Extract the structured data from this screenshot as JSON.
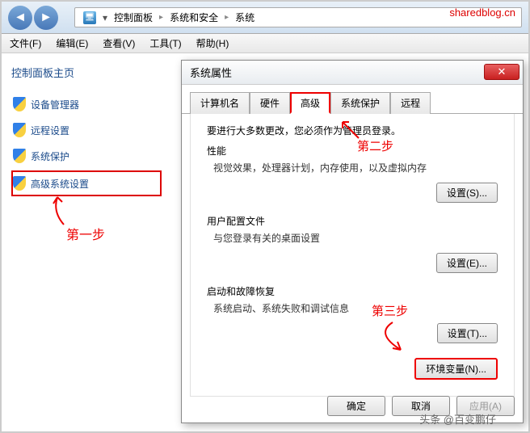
{
  "watermark_top": "sharedblog.cn",
  "watermark_bottom": "头条 @百变鹏仔",
  "nav": {
    "breadcrumb": [
      "控制面板",
      "系统和安全",
      "系统"
    ]
  },
  "menubar": [
    "文件(F)",
    "编辑(E)",
    "查看(V)",
    "工具(T)",
    "帮助(H)"
  ],
  "sidebar": {
    "title": "控制面板主页",
    "items": [
      "设备管理器",
      "远程设置",
      "系统保护",
      "高级系统设置"
    ]
  },
  "annotations": {
    "step1": "第一步",
    "step2": "第二步",
    "step3": "第三步"
  },
  "dialog": {
    "title": "系统属性",
    "close": "✕",
    "tabs": [
      "计算机名",
      "硬件",
      "高级",
      "系统保护",
      "远程"
    ],
    "notice": "要进行大多数更改，您必须作为管理员登录。",
    "sections": [
      {
        "title": "性能",
        "desc": "视觉效果，处理器计划，内存使用，以及虚拟内存",
        "btn": "设置(S)..."
      },
      {
        "title": "用户配置文件",
        "desc": "与您登录有关的桌面设置",
        "btn": "设置(E)..."
      },
      {
        "title": "启动和故障恢复",
        "desc": "系统启动、系统失败和调试信息",
        "btn": "设置(T)..."
      }
    ],
    "env_btn": "环境变量(N)...",
    "footer": {
      "ok": "确定",
      "cancel": "取消",
      "apply": "应用(A)"
    }
  }
}
